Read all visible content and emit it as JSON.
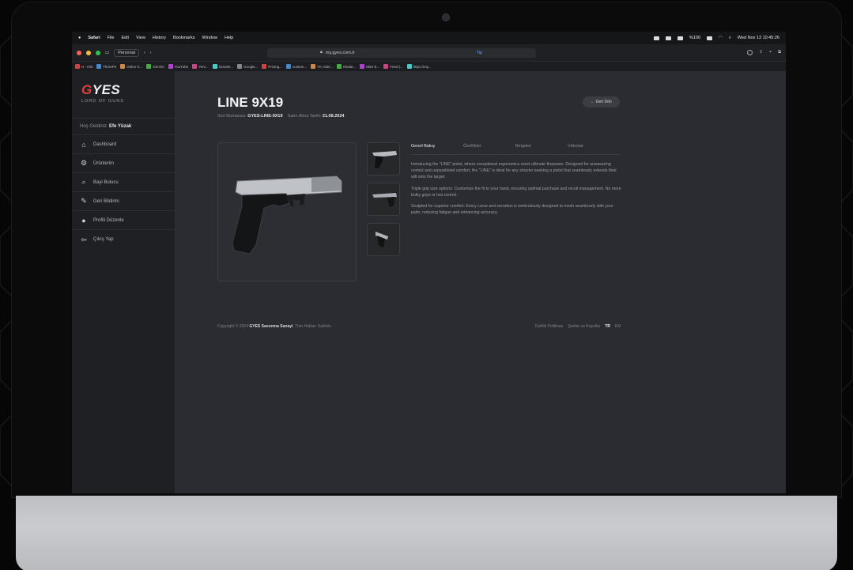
{
  "menubar": {
    "items": [
      "Safari",
      "File",
      "Edit",
      "View",
      "History",
      "Bookmarks",
      "Window",
      "Help"
    ],
    "clock": "Wed Nov 13 10:45:26",
    "battery": "%100"
  },
  "browser": {
    "profile": "Personal",
    "url": "my.gyes.com.tr",
    "tip": "Tip"
  },
  "bookmarks": [
    "H - Hitt",
    "ThreePe",
    "Gelen K...",
    "Gemini",
    "YouTube",
    "Yeni... ",
    "Günder...",
    "Google...",
    "Pricing...",
    "custom...",
    "YK Adet...",
    "Ithalat...",
    "Mürt E...",
    "Feed |...",
    "https://my..."
  ],
  "sidebar": {
    "logo": "GYES",
    "logo_sub": "LORD OF GUNS",
    "welcome_prefix": "Hoş Geldiniz",
    "welcome_name": "Efe Yüzak",
    "items": [
      {
        "label": "Dashboard",
        "icon": "home-icon"
      },
      {
        "label": "Ürünlerim",
        "icon": "gear-icon"
      },
      {
        "label": "Bayi Bulucu",
        "icon": "search-icon"
      },
      {
        "label": "Geri Bildirim",
        "icon": "feedback-icon"
      },
      {
        "label": "Profili Düzenle",
        "icon": "user-icon"
      },
      {
        "label": "Çıkış Yap",
        "icon": "logout-icon"
      }
    ]
  },
  "product": {
    "title": "LINE 9X19",
    "serial_label": "Seri Numarası:",
    "serial": "GYES-LINE-9X19",
    "purchase_label": "Satın Alma Tarihi:",
    "purchase_date": "21.08.2024",
    "back_label": "← Geri Dön"
  },
  "tabs": [
    "Genel Bakış",
    "Özellikler",
    "Belgeler",
    "Videolar"
  ],
  "description": [
    "Introducing the \"LINE\" pistol, where exceptional ergonomics meet ultimate firepower. Designed for unwavering control and unparalleled comfort, the \"LINE\" is ideal for any shooter seeking a pistol that seamlessly extends their will onto the target.",
    "Triple grip size options: Customize the fit to your hand, ensuring optimal purchase and recoil management. No more bulky grips or lost control.",
    "Sculpted for superior comfort: Every curve and serration is meticulously designed to mesh seamlessly with your palm, reducing fatigue and enhancing accuracy."
  ],
  "footer": {
    "copyright_prefix": "Copyright © 2024",
    "company": "GYES Savunma Sanayi",
    "rights": ". Tüm Hakları Saklıdır.",
    "privacy": "Gizlilik Politikası",
    "terms": "Şartlar ve Koşullar",
    "lang_tr": "TR",
    "lang_en": "EN"
  }
}
